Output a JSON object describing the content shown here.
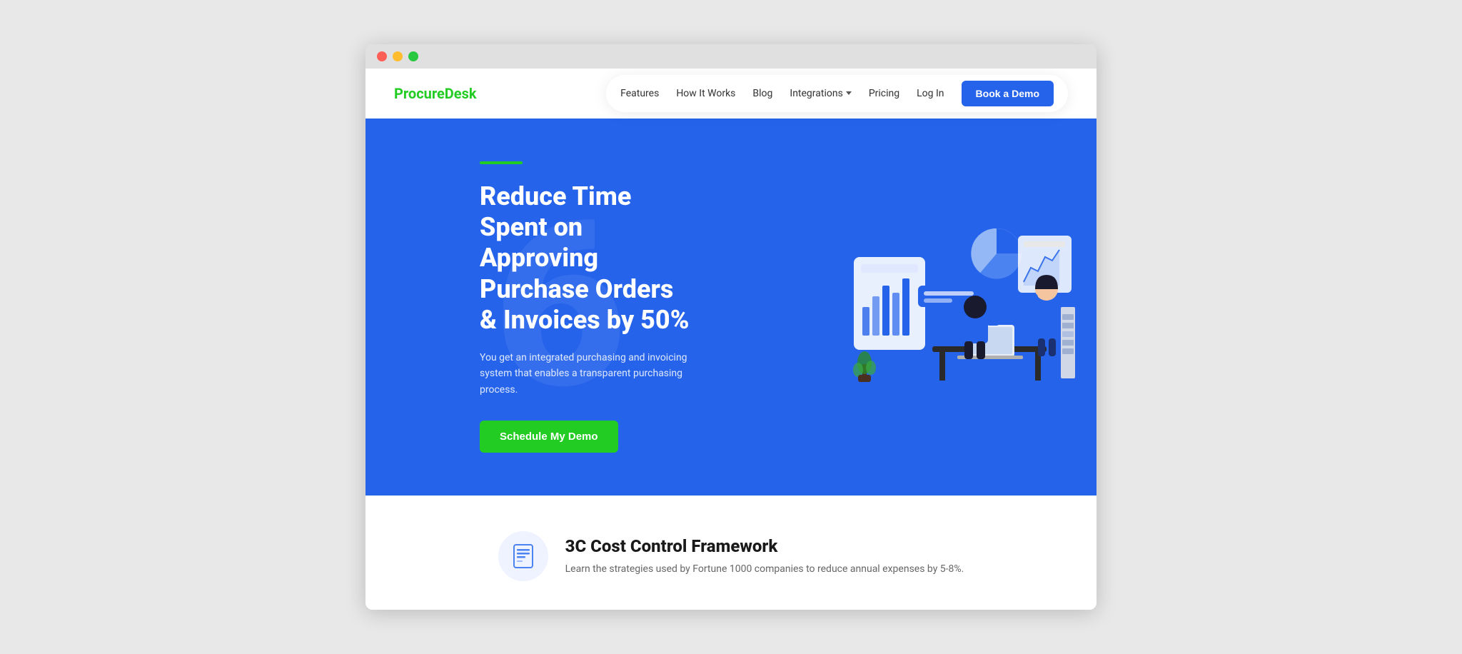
{
  "browser": {
    "dots": [
      "red",
      "yellow",
      "green"
    ]
  },
  "header": {
    "logo_text": "Procure",
    "logo_accent": "Desk",
    "nav_items": [
      {
        "label": "Features",
        "has_dropdown": false
      },
      {
        "label": "How It Works",
        "has_dropdown": false
      },
      {
        "label": "Blog",
        "has_dropdown": false
      },
      {
        "label": "Integrations",
        "has_dropdown": true
      },
      {
        "label": "Pricing",
        "has_dropdown": false
      },
      {
        "label": "Log In",
        "has_dropdown": false
      }
    ],
    "book_demo_label": "Book a Demo"
  },
  "hero": {
    "accent_line": true,
    "title": "Reduce Time Spent on Approving Purchase Orders & Invoices by 50%",
    "subtitle": "You get an integrated purchasing and invoicing system that enables a transparent purchasing process.",
    "cta_label": "Schedule My Demo",
    "big_number": "6"
  },
  "lower": {
    "icon_unicode": "📋",
    "heading": "3C Cost Control Framework",
    "description": "Learn the strategies used by Fortune 1000 companies to reduce annual expenses by 5-8%."
  }
}
